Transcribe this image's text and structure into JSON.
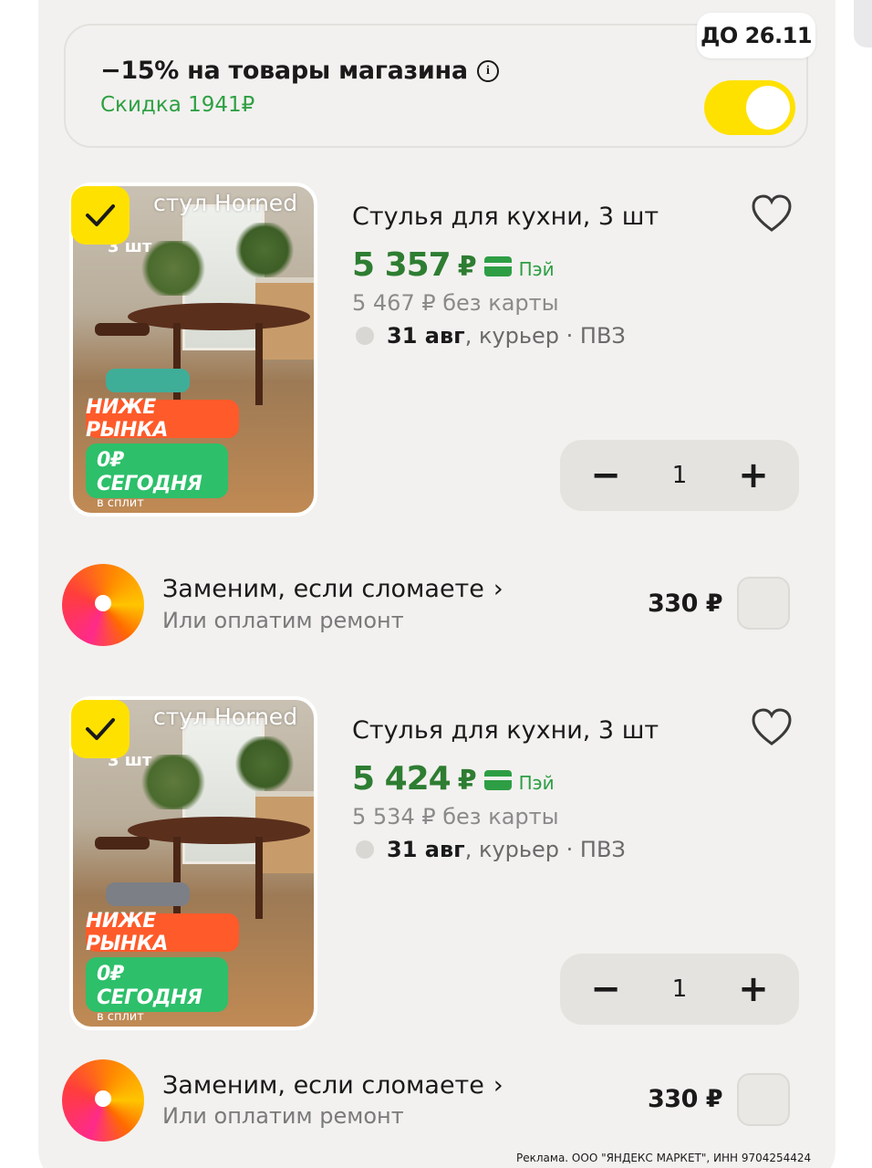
{
  "promo": {
    "title": "−15% на товары магазина",
    "info_icon": "info-icon",
    "discount": "Скидка 1941₽",
    "deadline": "ДО 26.11",
    "toggle_on": true,
    "accent_color": "#ffe100",
    "discount_color": "#2ea043"
  },
  "products": [
    {
      "image_caption": "стул Horned",
      "image_pcs": "3 шт",
      "badge_low": "НИЖЕ РЫНКА",
      "badge_split": "0₽ СЕГОДНЯ",
      "badge_split_sub": "в сплит",
      "title": "Стулья для кухни, 3 шт",
      "price": "5 357",
      "currency": "₽",
      "pay_label": "Пэй",
      "old_price": "5 467 ₽ без карты",
      "delivery_date": "31 авг",
      "delivery_rest": ", курьер · ПВЗ",
      "qty": "1",
      "minus": "−",
      "plus": "+",
      "selected": true
    },
    {
      "image_caption": "стул Horned",
      "image_pcs": "3 шт",
      "badge_low": "НИЖЕ РЫНКА",
      "badge_split": "0₽ СЕГОДНЯ",
      "badge_split_sub": "в сплит",
      "title": "Стулья для кухни, 3 шт",
      "price": "5 424",
      "currency": "₽",
      "pay_label": "Пэй",
      "old_price": "5 534 ₽ без карты",
      "delivery_date": "31 авг",
      "delivery_rest": ", курьер · ПВЗ",
      "qty": "1",
      "minus": "−",
      "plus": "+",
      "selected": true
    }
  ],
  "services": [
    {
      "title": "Заменим, если сломаете",
      "chevron": "›",
      "subtitle": "Или оплатим ремонт",
      "price": "330 ₽",
      "checked": false
    },
    {
      "title": "Заменим, если сломаете",
      "chevron": "›",
      "subtitle": "Или оплатим ремонт",
      "price": "330 ₽",
      "checked": false
    }
  ],
  "ad_text": "Реклама. ООО \"ЯНДЕКС МАРКЕТ\", ИНН 9704254424",
  "colors": {
    "price_green": "#2e7d32",
    "badge_orange": "#ff5a2a",
    "badge_green": "#2dbf6a",
    "background": "#f2f1ef"
  }
}
